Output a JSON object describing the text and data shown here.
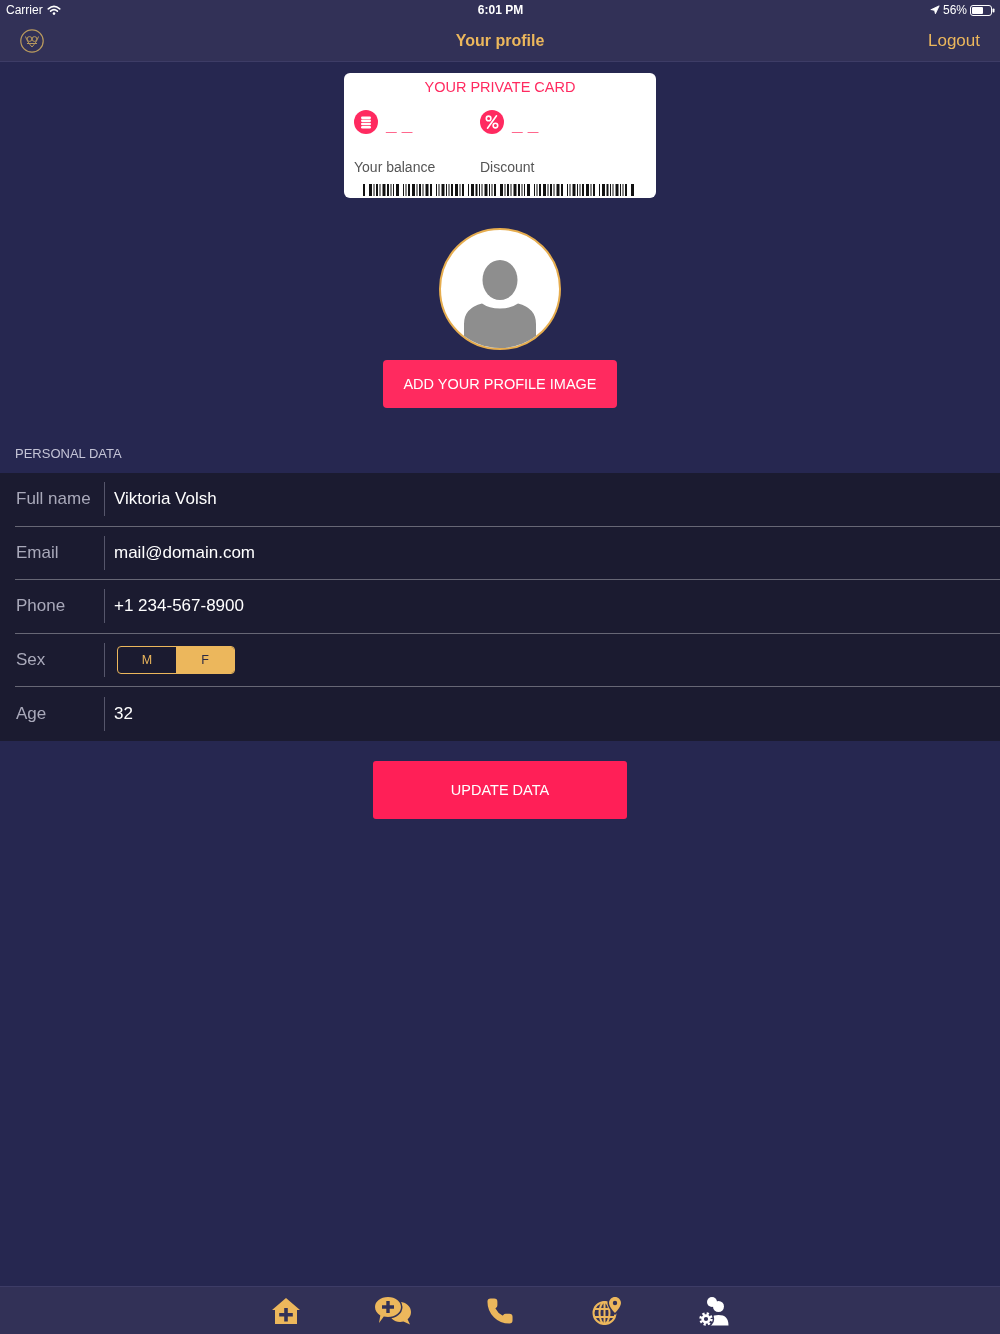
{
  "status_bar": {
    "carrier": "Carrier",
    "time": "6:01 PM",
    "battery": "56%"
  },
  "nav_bar": {
    "title": "Your profile",
    "action": "Logout"
  },
  "private_card": {
    "title": "YOUR PRIVATE CARD",
    "items": [
      {
        "kind": "balance",
        "value": "_ _",
        "label": "Your balance"
      },
      {
        "kind": "discount",
        "value": "_ _",
        "label": "Discount"
      }
    ]
  },
  "profile_image": {
    "button": "ADD YOUR PROFILE IMAGE"
  },
  "personal_data": {
    "heading": "PERSONAL DATA",
    "fields": [
      {
        "kind": "text",
        "label": "Full name",
        "value": "Viktoria Volsh"
      },
      {
        "kind": "text",
        "label": "Email",
        "value": "mail@domain.com"
      },
      {
        "kind": "text",
        "label": "Phone",
        "value": "+1 234-567-8900"
      },
      {
        "kind": "choice",
        "label": "Sex",
        "options": [
          {
            "label": "M",
            "selected": false
          },
          {
            "label": "F",
            "selected": true
          }
        ]
      },
      {
        "kind": "text",
        "label": "Age",
        "value": "32"
      }
    ]
  },
  "update_button": "UPDATE DATA",
  "tab_bar": [
    {
      "kind": "home",
      "selected": false
    },
    {
      "kind": "chat",
      "selected": false
    },
    {
      "kind": "phone",
      "selected": false
    },
    {
      "kind": "globe",
      "selected": false
    },
    {
      "kind": "profile",
      "selected": true
    }
  ]
}
